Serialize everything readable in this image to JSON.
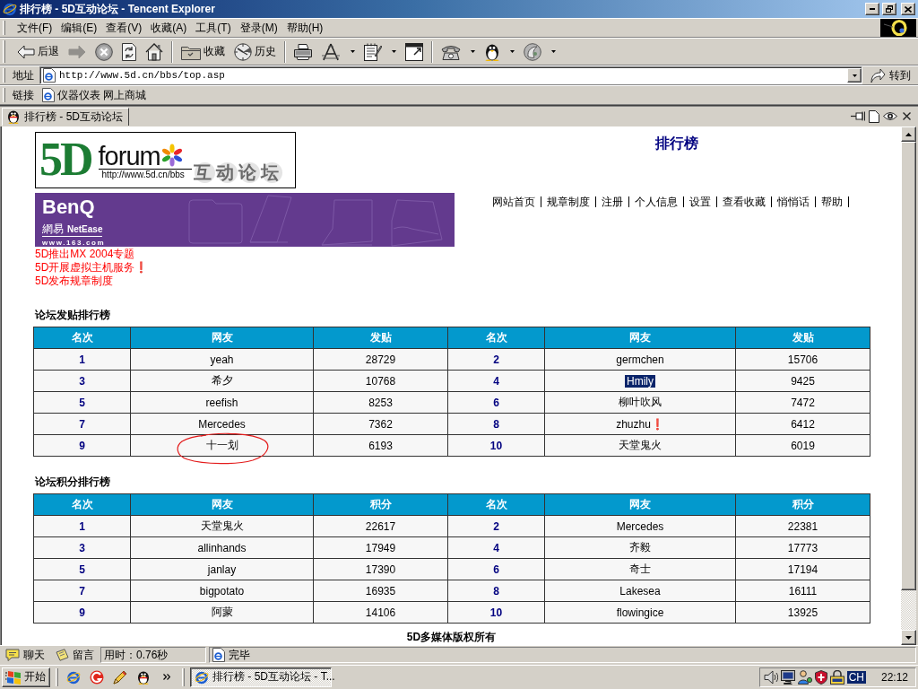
{
  "window": {
    "title": "排行榜 - 5D互动论坛 - Tencent Explorer"
  },
  "menu": [
    "文件(F)",
    "编辑(E)",
    "查看(V)",
    "收藏(A)",
    "工具(T)",
    "登录(M)",
    "帮助(H)"
  ],
  "toolbar": {
    "groups": [
      [
        {
          "kind": "back",
          "label": "后退",
          "dropdown": false,
          "disabled": false
        },
        {
          "kind": "forward",
          "dropdown": false,
          "disabled": true
        },
        {
          "kind": "stop",
          "dropdown": false,
          "disabled": false
        },
        {
          "kind": "refresh",
          "dropdown": false,
          "disabled": false
        },
        {
          "kind": "home",
          "dropdown": false,
          "disabled": false
        }
      ],
      [
        {
          "kind": "favorites",
          "label": "收藏",
          "dropdown": false,
          "disabled": false
        },
        {
          "kind": "history",
          "label": "历史",
          "dropdown": false,
          "disabled": false
        }
      ],
      [
        {
          "kind": "print",
          "dropdown": false,
          "disabled": false
        },
        {
          "kind": "font",
          "dropdown": true,
          "disabled": false
        },
        {
          "kind": "edit",
          "dropdown": true,
          "disabled": false
        },
        {
          "kind": "window",
          "dropdown": false,
          "disabled": false
        }
      ],
      [
        {
          "kind": "phone",
          "dropdown": true,
          "disabled": false
        },
        {
          "kind": "penguin",
          "dropdown": true,
          "disabled": false
        },
        {
          "kind": "swirl",
          "dropdown": true,
          "disabled": false
        }
      ]
    ]
  },
  "address": {
    "label": "地址",
    "value": "http://www.5d.cn/bbs/top.asp",
    "go": "转到"
  },
  "links": {
    "label": "链接",
    "items": [
      "仪器仪表 网上商城"
    ]
  },
  "tabs": [
    {
      "label": "排行榜 - 5D互动论坛",
      "selected": true
    }
  ],
  "page": {
    "logo": {
      "mark": "5D",
      "word": "forum",
      "url": "http://www.5d.cn/bbs",
      "tagline": "互动论坛"
    },
    "title": "排行榜",
    "banner": {
      "brand": "BenQ",
      "partner": "網易",
      "partner_latin": "NetEase",
      "site": "www.163.com"
    },
    "nav": [
      "网站首页",
      "规章制度",
      "注册",
      "个人信息",
      "设置",
      "查看收藏",
      "悄悄话",
      "帮助"
    ],
    "notices": [
      "5D推出MX 2004专题",
      "5D开展虚拟主机服务❗",
      "5D发布规章制度"
    ],
    "rankings": [
      {
        "title": "论坛发贴排行榜",
        "columns": [
          "名次",
          "网友",
          "发贴",
          "名次",
          "网友",
          "发贴"
        ],
        "rows": [
          [
            {
              "rank": "1",
              "user": "yeah",
              "value": "28729",
              "highlighted": false,
              "circled": false
            },
            {
              "rank": "2",
              "user": "germchen",
              "value": "15706",
              "highlighted": false,
              "circled": false
            }
          ],
          [
            {
              "rank": "3",
              "user": "希夕",
              "value": "10768",
              "highlighted": false,
              "circled": false
            },
            {
              "rank": "4",
              "user": "Hmily",
              "value": "9425",
              "highlighted": true,
              "circled": false
            }
          ],
          [
            {
              "rank": "5",
              "user": "reefish",
              "value": "8253",
              "highlighted": false,
              "circled": false
            },
            {
              "rank": "6",
              "user": "柳叶吹风",
              "value": "7472",
              "highlighted": false,
              "circled": false
            }
          ],
          [
            {
              "rank": "7",
              "user": "Mercedes",
              "value": "7362",
              "highlighted": false,
              "circled": false
            },
            {
              "rank": "8",
              "user": "zhuzhu❗",
              "value": "6412",
              "highlighted": false,
              "circled": false
            }
          ],
          [
            {
              "rank": "9",
              "user": "十一划",
              "value": "6193",
              "highlighted": false,
              "circled": true
            },
            {
              "rank": "10",
              "user": "天堂鬼火",
              "value": "6019",
              "highlighted": false,
              "circled": false
            }
          ]
        ]
      },
      {
        "title": "论坛积分排行榜",
        "columns": [
          "名次",
          "网友",
          "积分",
          "名次",
          "网友",
          "积分"
        ],
        "rows": [
          [
            {
              "rank": "1",
              "user": "天堂鬼火",
              "value": "22617",
              "highlighted": false,
              "circled": false
            },
            {
              "rank": "2",
              "user": "Mercedes",
              "value": "22381",
              "highlighted": false,
              "circled": false
            }
          ],
          [
            {
              "rank": "3",
              "user": "allinhands",
              "value": "17949",
              "highlighted": false,
              "circled": false
            },
            {
              "rank": "4",
              "user": "齐毅",
              "value": "17773",
              "highlighted": false,
              "circled": false
            }
          ],
          [
            {
              "rank": "5",
              "user": "janlay",
              "value": "17390",
              "highlighted": false,
              "circled": false
            },
            {
              "rank": "6",
              "user": "奇士",
              "value": "17194",
              "highlighted": false,
              "circled": false
            }
          ],
          [
            {
              "rank": "7",
              "user": "bigpotato",
              "value": "16935",
              "highlighted": false,
              "circled": false
            },
            {
              "rank": "8",
              "user": "Lakesea",
              "value": "16111",
              "highlighted": false,
              "circled": false
            }
          ],
          [
            {
              "rank": "9",
              "user": "阿蒙",
              "value": "14106",
              "highlighted": false,
              "circled": false
            },
            {
              "rank": "10",
              "user": "flowingice",
              "value": "13925",
              "highlighted": false,
              "circled": false
            }
          ]
        ]
      }
    ],
    "footer": "5D多媒体版权所有"
  },
  "status_bar": {
    "chat": "聊天",
    "message": "留言",
    "elapsed": "用时：0.76秒",
    "state": "完毕"
  },
  "taskbar": {
    "start": "开始",
    "tasks": [
      {
        "label": "排行榜 - 5D互动论坛 - T...",
        "active": true
      }
    ],
    "language": "CH",
    "clock": "22:12"
  }
}
